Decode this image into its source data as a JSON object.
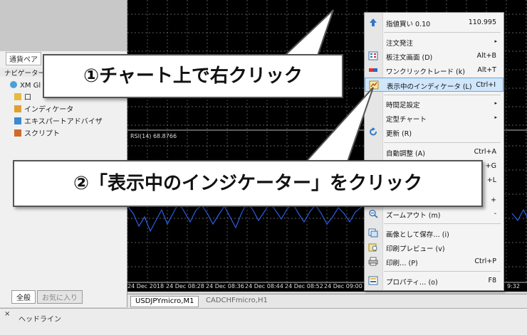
{
  "left_panel": {
    "currency_tab": "通貨ペア",
    "navigator_title": "ナビゲーター",
    "tree": [
      "XM Gl",
      "口",
      "インディケータ",
      "エキスパートアドバイザ",
      "スクリプト"
    ],
    "bottom_tabs": [
      "全般",
      "お気に入り"
    ]
  },
  "chart": {
    "rsi_label": "RSI(14) 68.8766",
    "time_labels": [
      "24 Dec 2018",
      "24 Dec 08:28",
      "24 Dec 08:36",
      "24 Dec 08:44",
      "24 Dec 08:52",
      "24 Dec 09:00",
      "9:32",
      "24 Dec"
    ],
    "tabs": [
      "USDJPYmicro,M1",
      "CADCHFmicro,H1"
    ],
    "line_color": "#2a5fe8"
  },
  "headline": {
    "close": "×",
    "label": "ヘッドライン"
  },
  "context_menu": {
    "items": [
      {
        "label": "指値買い 0.10",
        "shortcut": "110.995",
        "icon": "arrow-up-icon"
      },
      {
        "label": "注文発注",
        "submenu": "▸"
      },
      {
        "label": "板注文画面 (D)",
        "shortcut": "Alt+B",
        "icon": "order-board-icon"
      },
      {
        "label": "ワンクリックトレード (k)",
        "shortcut": "Alt+T",
        "icon": "one-click-icon"
      },
      {
        "label": "表示中のインディケータ (L)",
        "shortcut": "Ctrl+I",
        "icon": "indicator-list-icon"
      },
      {
        "label": "時間足設定",
        "submenu": "▸"
      },
      {
        "label": "定型チャート",
        "submenu": "▸"
      },
      {
        "label": "更新 (R)",
        "icon": "refresh-icon"
      },
      {
        "label": "自動調整 (A)",
        "shortcut": "Ctrl+A"
      },
      {
        "label": "",
        "shortcut": "+G"
      },
      {
        "label": "",
        "shortcut": "+L"
      },
      {
        "label": "",
        "shortcut": "+"
      },
      {
        "label": "ズームアウト (m)",
        "shortcut": "-",
        "icon": "zoom-out-icon"
      },
      {
        "label": "画像として保存… (i)",
        "icon": "save-image-icon"
      },
      {
        "label": "印刷プレビュー (v)",
        "icon": "print-preview-icon"
      },
      {
        "label": "印刷… (P)",
        "shortcut": "Ctrl+P",
        "icon": "print-icon"
      },
      {
        "label": "プロパティ… (o)",
        "shortcut": "F8",
        "icon": "properties-icon"
      }
    ]
  },
  "annotations": {
    "step1": "①チャート上で右クリック",
    "step2": "②「表示中のインジケーター」をクリック"
  }
}
